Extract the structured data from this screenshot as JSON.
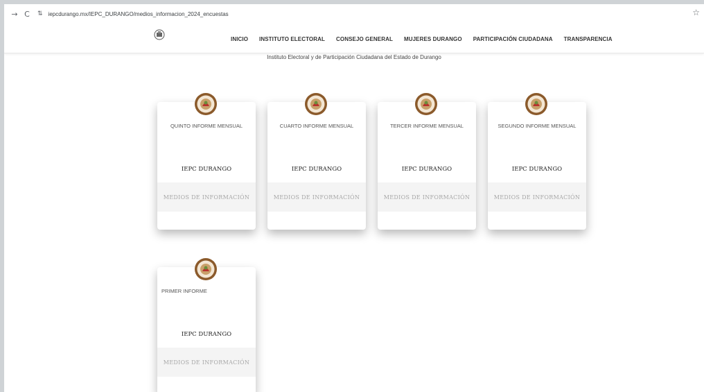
{
  "browser": {
    "url": "iepcdurango.mx/IEPC_DURANGO/medios_informacion_2024_encuestas"
  },
  "nav": {
    "items": [
      {
        "label": "INICIO"
      },
      {
        "label": "INSTITUTO ELECTORAL"
      },
      {
        "label": "CONSEJO GENERAL"
      },
      {
        "label": "MUJERES DURANGO"
      },
      {
        "label": "PARTICIPACIÓN CIUDADANA"
      },
      {
        "label": "TRANSPARENCIA"
      }
    ]
  },
  "subtitle": "Instituto Electoral y de Participación Ciudadana del Estado de Durango",
  "cards": [
    {
      "title": "QUINTO INFORME MENSUAL",
      "org": "IEPC DURANGO",
      "band": "MEDIOS DE INFORMACIÓN"
    },
    {
      "title": "CUARTO INFORME MENSUAL",
      "org": "IEPC DURANGO",
      "band": "MEDIOS DE INFORMACIÓN"
    },
    {
      "title": "TERCER INFORME MENSUAL",
      "org": "IEPC DURANGO",
      "band": "MEDIOS DE INFORMACIÓN"
    },
    {
      "title": "SEGUNDO INFORME MENSUAL",
      "org": "IEPC DURANGO",
      "band": "MEDIOS DE INFORMACIÓN"
    },
    {
      "title": "PRIMER INFORME",
      "org": "IEPC DURANGO",
      "band": "MEDIOS DE INFORMACIÓN"
    }
  ],
  "icons": {
    "back": "arrow-back-icon",
    "reload": "reload-icon",
    "site_settings": "tune-icon",
    "bookmark": "star-icon",
    "logo": "iepc-logo"
  },
  "colors": {
    "logo_ring": "#8b5a2b",
    "logo_inner": "#c9a06a",
    "band_bg": "#f4f4f4",
    "band_text": "#a7a7a7"
  }
}
